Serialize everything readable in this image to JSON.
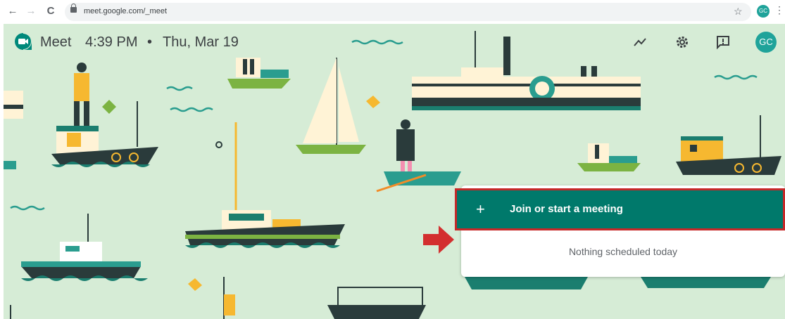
{
  "browser": {
    "back": "←",
    "forward": "→",
    "reload": "C",
    "url": "meet.google.com/_meet",
    "star": "☆",
    "avatar": "GC",
    "menu": "⋮"
  },
  "header": {
    "app_name": "Meet",
    "time": "4:39 PM",
    "separator": "•",
    "date": "Thu, Mar 19",
    "avatar": "GC",
    "icons": [
      "quality-icon",
      "settings-gear-icon",
      "feedback-icon"
    ]
  },
  "card": {
    "plus": "+",
    "join_label": "Join or start a meeting",
    "empty_message": "Nothing scheduled today"
  },
  "colors": {
    "background": "#d6ecd6",
    "accent": "#00796b",
    "avatar": "#1fa39a",
    "highlight": "#c62828"
  }
}
